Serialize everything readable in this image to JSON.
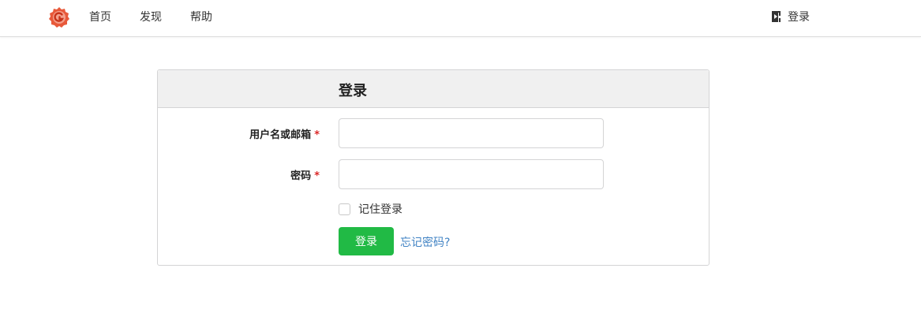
{
  "colors": {
    "primary_green": "#21ba45",
    "link_blue": "#4183c4",
    "required_red": "#db2828",
    "logo_orange": "#e8593a"
  },
  "navbar": {
    "logo_icon": "gitea-logo-icon",
    "items": [
      {
        "label": "首页"
      },
      {
        "label": "发现"
      },
      {
        "label": "帮助"
      }
    ],
    "signin": {
      "icon": "sign-in-icon",
      "label": "登录"
    }
  },
  "login": {
    "title": "登录",
    "username": {
      "label": "用户名或邮箱",
      "required_mark": "*",
      "value": "",
      "placeholder": ""
    },
    "password": {
      "label": "密码",
      "required_mark": "*",
      "value": "",
      "placeholder": ""
    },
    "remember_label": "记住登录",
    "submit_label": "登录",
    "forgot_label": "忘记密码?"
  }
}
